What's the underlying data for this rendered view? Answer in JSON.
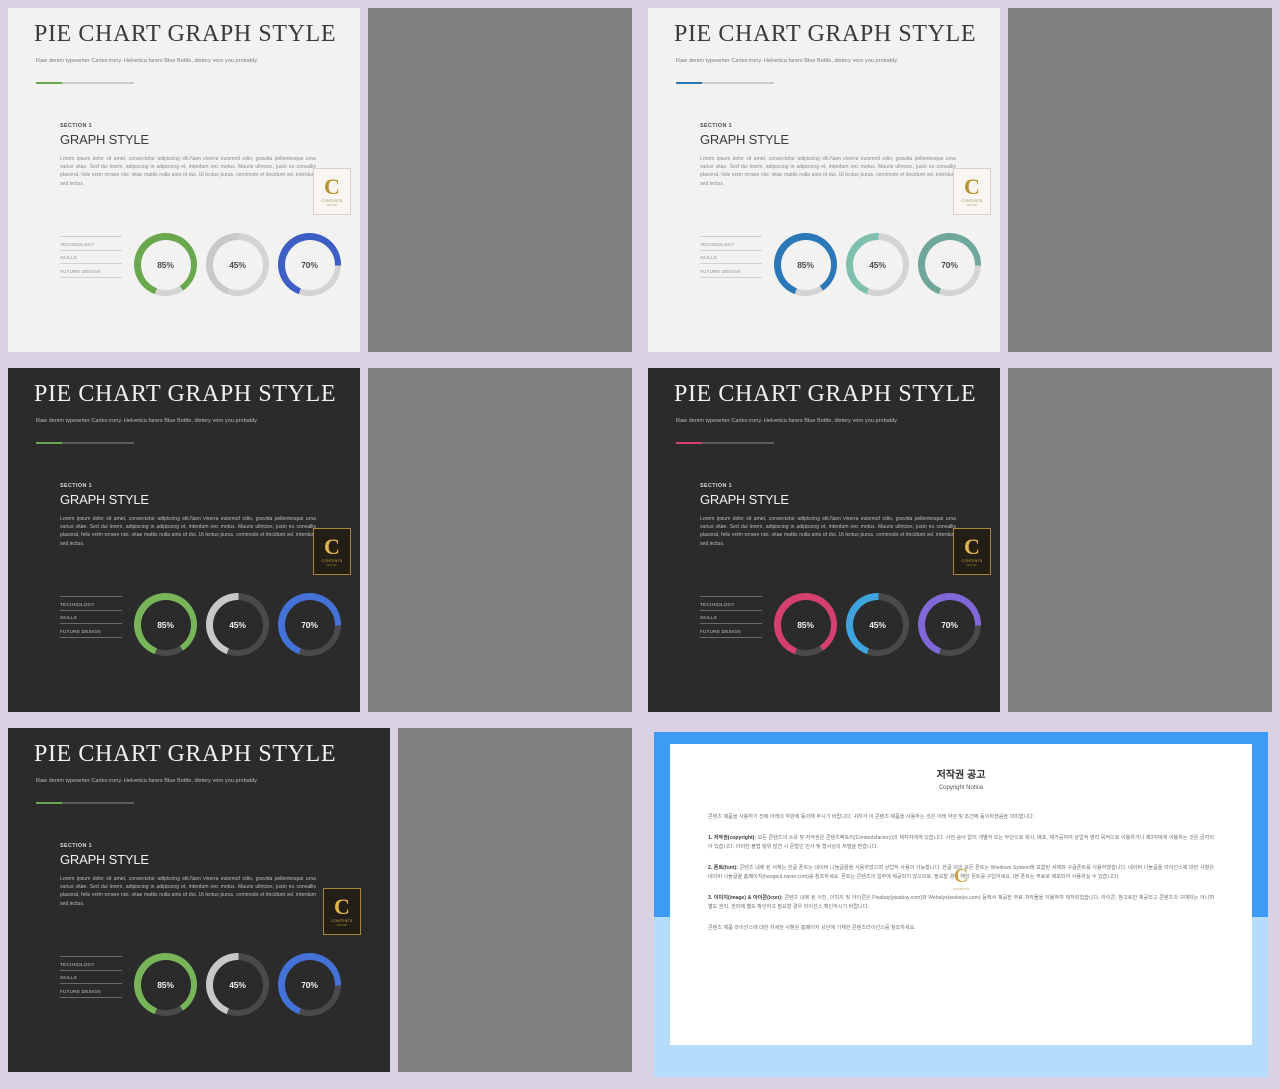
{
  "slides": [
    {
      "id": "slide-1-light-green",
      "theme": "light",
      "title": "PIE CHART GRAPH STYLE",
      "subtitle": "Raw denim typewriter Carles irony. Helvetica farers Blue Bottle, distery vero you probably.",
      "accent": "#6aa84f",
      "section_label": "SECTION 1",
      "section_heading": "GRAPH STYLE",
      "body": "Lorem ipsum dolor sit amet, consectetur adipiscing elit.Nam viverra euismod odio, gravida pellentesque urna varius vitae. Sed dui lorem, adipiscing in adipiscing et, interdum nec metus. Mauris ultricies, justo eu convallis placerat, felis enim ornare nisi, vitae mattis nulla ante id dui. Ut lectus purus, commodo et tincidunt vel, interdum sed lectus.",
      "legend": [
        "TECHNOLOGY",
        "SKILLS",
        "FUTURE DESIGN"
      ],
      "chart_data": {
        "type": "pie",
        "title": "GRAPH STYLE",
        "categories": [
          "TECHNOLOGY",
          "SKILLS",
          "FUTURE DESIGN"
        ],
        "values": [
          85,
          45,
          70
        ],
        "labels": [
          "85%",
          "45%",
          "70%"
        ],
        "colors": [
          "#6aa84f",
          "#c9c9c9",
          "#3d5ec4"
        ],
        "track_color": "#d4d4d4",
        "ylim": [
          0,
          100
        ]
      }
    },
    {
      "id": "slide-2-light-blue",
      "theme": "light",
      "title": "PIE CHART GRAPH STYLE",
      "subtitle": "Raw denim typewriter Carles irony. Helvetica farers Blue Bottle, distery vero you probably.",
      "accent": "#2b78b8",
      "section_label": "SECTION 1",
      "section_heading": "GRAPH STYLE",
      "body": "Lorem ipsum dolor sit amet, consectetur adipiscing elit.Nam viverra euismod odio, gravida pellentesque urna varius vitae. Sed dui lorem, adipiscing in adipiscing et, interdum nec metus. Mauris ultricies, justo eu convallis placerat, felis enim ornare nisi, vitae mattis nulla ante id dui. Ut lectus purus, commodo et tincidunt vel, interdum sed lectus.",
      "legend": [
        "TECHNOLOGY",
        "SKILLS",
        "FUTURE DESIGN"
      ],
      "chart_data": {
        "type": "pie",
        "title": "GRAPH STYLE",
        "categories": [
          "TECHNOLOGY",
          "SKILLS",
          "FUTURE DESIGN"
        ],
        "values": [
          85,
          45,
          70
        ],
        "labels": [
          "85%",
          "45%",
          "70%"
        ],
        "colors": [
          "#2b78b8",
          "#7fbfae",
          "#6fa79b"
        ],
        "track_color": "#d4d4d4",
        "ylim": [
          0,
          100
        ]
      }
    },
    {
      "id": "slide-3-dark-green",
      "theme": "dark",
      "title": "PIE CHART GRAPH STYLE",
      "subtitle": "Raw denim typewriter Carles irony. Helvetica farers Blue Bottle, distery vero you probably.",
      "accent": "#6aa84f",
      "section_label": "SECTION 1",
      "section_heading": "GRAPH STYLE",
      "body": "Lorem ipsum dolor sit amet, consectetur adipiscing elit.Nam viverra euismod odio, gravida pellentesque urna varius vitae. Sed dui lorem, adipiscing in adipiscing et, interdum nec metus. Mauris ultricies, justo eu convallis placerat, felis enim ornare nisi, vitae mattis nulla ante id dui. Ut lectus purus, commodo et tincidunt vel, interdum sed lectus.",
      "legend": [
        "TECHNOLOGY",
        "SKILLS",
        "FUTURE DESIGN"
      ],
      "chart_data": {
        "type": "pie",
        "title": "GRAPH STYLE",
        "categories": [
          "TECHNOLOGY",
          "SKILLS",
          "FUTURE DESIGN"
        ],
        "values": [
          85,
          45,
          70
        ],
        "labels": [
          "85%",
          "45%",
          "70%"
        ],
        "colors": [
          "#77b558",
          "#c8c8c8",
          "#4472d8"
        ],
        "track_color": "#4a4a4a",
        "ylim": [
          0,
          100
        ]
      }
    },
    {
      "id": "slide-4-dark-pink",
      "theme": "dark",
      "title": "PIE CHART GRAPH STYLE",
      "subtitle": "Raw denim typewriter Carles irony. Helvetica farers Blue Bottle, distery vero you probably.",
      "accent": "#d6406e",
      "section_label": "SECTION 1",
      "section_heading": "GRAPH STYLE",
      "body": "Lorem ipsum dolor sit amet, consectetur adipiscing elit.Nam viverra euismod odio, gravida pellentesque urna varius vitae. Sed dui lorem, adipiscing in adipiscing et, interdum nec metus. Mauris ultricies, justo eu convallis placerat, felis enim ornare nisi, vitae mattis nulla ante id dui. Ut lectus purus, commodo et tincidunt vel, interdum sed lectus.",
      "legend": [
        "TECHNOLOGY",
        "SKILLS",
        "FUTURE DESIGN"
      ],
      "chart_data": {
        "type": "pie",
        "title": "GRAPH STYLE",
        "categories": [
          "TECHNOLOGY",
          "SKILLS",
          "FUTURE DESIGN"
        ],
        "values": [
          85,
          45,
          70
        ],
        "labels": [
          "85%",
          "45%",
          "70%"
        ],
        "colors": [
          "#d6406e",
          "#3fa3dd",
          "#8168d8"
        ],
        "track_color": "#4a4a4a",
        "ylim": [
          0,
          100
        ]
      }
    },
    {
      "id": "slide-5-dark-green-wide",
      "theme": "dark",
      "title": "PIE CHART GRAPH STYLE",
      "subtitle": "Raw denim typewriter Carles irony. Helvetica farers Blue Bottle, distery vero you probably.",
      "accent": "#6aa84f",
      "section_label": "SECTION 1",
      "section_heading": "GRAPH STYLE",
      "body": "Lorem ipsum dolor sit amet, consectetur adipiscing elit.Nam viverra euismod odio, gravida pellentesque urna varius vitae. Sed dui lorem, adipiscing in adipiscing et, interdum nec metus. Mauris ultricies, justo eu convallis placerat, felis enim ornare nisi, vitae mattis nulla ante id dui. Ut lectus purus, commodo et tincidunt vel, interdum sed lectus.",
      "legend": [
        "TECHNOLOGY",
        "SKILLS",
        "FUTURE DESIGN"
      ],
      "chart_data": {
        "type": "pie",
        "title": "GRAPH STYLE",
        "categories": [
          "TECHNOLOGY",
          "SKILLS",
          "FUTURE DESIGN"
        ],
        "values": [
          85,
          45,
          70
        ],
        "labels": [
          "85%",
          "45%",
          "70%"
        ],
        "colors": [
          "#77b558",
          "#c8c8c8",
          "#4472d8"
        ],
        "track_color": "#4a4a4a",
        "ylim": [
          0,
          100
        ]
      }
    }
  ],
  "badge": {
    "glyph": "C",
    "word": "CONTENTS",
    "sub": "FACTORY"
  },
  "copyright": {
    "title": "저작권 공고",
    "subtitle": "Copyright Notice",
    "intro": "콘텐츠 제품을 사용하기 전에 아래의 약관에 동의해 주시기 바랍니다. 귀하가 이 콘텐츠 제품을 사용하는 것은 아래 약관 및 조건에 동의하셨음을 의미합니다.",
    "items": [
      {
        "heading": "1. 저작권(copyright):",
        "text": "모든 콘텐츠의 소유 및 저작권은 콘텐츠팩토리(Contentsfactory)의 제작자에게 있습니다. 사전 승낙 없이 개별적 또는 무단으로 복사, 배포, 재가공하여 상업적 영리 목적으로 이용하거나 제3자에게 이용하는 것은 금지되어 있습니다. 이러한 불법 행위 발견 시 준법인 민사 및 형사상의 처벌을 받습니다."
      },
      {
        "heading": "2. 폰트(font):",
        "text": "콘텐츠 내에 된 서체는 한글 폰트는 네이버 나눔글꼴을 사용하였으며 상업적 사용이 가능합니다. 한글 외의 모든 폰트는 Windows System에 포함된 서체와 구글폰트를 사용하였습니다. 네이버 나눔글꼴 라이선스에 대한 사항은 네이버 나눔글꼴 홈페이지(hangeul.naver.com)를 참조하세요. 폰트는 콘텐츠의 일부에 제공되지 않으므로, 필요할 경우 해당 폰트를 구입하세요. (본 폰트는 무료로 배포되어 사용하실 수 있습니다)"
      },
      {
        "heading": "3. 이미지(image) & 아이콘(icon):",
        "text": "콘텐츠 내에 된 사진, 이미지 및 아이콘은 Pixabay(pixabay.com)와 Webalys(webalys.com) 등에서 제공한 무료 저작물을 이용하여 제작되었습니다. 아이콘, 참고로만 제공되고 콘텐츠의 구매자는 아니며 별도 권리, 권리에 별도 확인하고 필요할 경우 라이선스 확인하시기 바랍니다."
      }
    ],
    "footer": "콘텐츠 제품 라이선스에 대한 자세한 사항은 홈페이지 상단에 기재한 콘텐츠라이선스를 참조하세요.",
    "logo": {
      "glyph": "C",
      "word": "CONTENTS"
    }
  },
  "colors": {
    "page_background": "#d9d2e2",
    "filler_panel": "#7f7f7f",
    "slide_light_bg": "#f2f2f0",
    "slide_dark_bg": "#2b2b2b",
    "copyright_frame_top": "#3d9bf5",
    "copyright_frame_bottom": "#b5dcfa",
    "copyright_page": "#ffffff"
  }
}
